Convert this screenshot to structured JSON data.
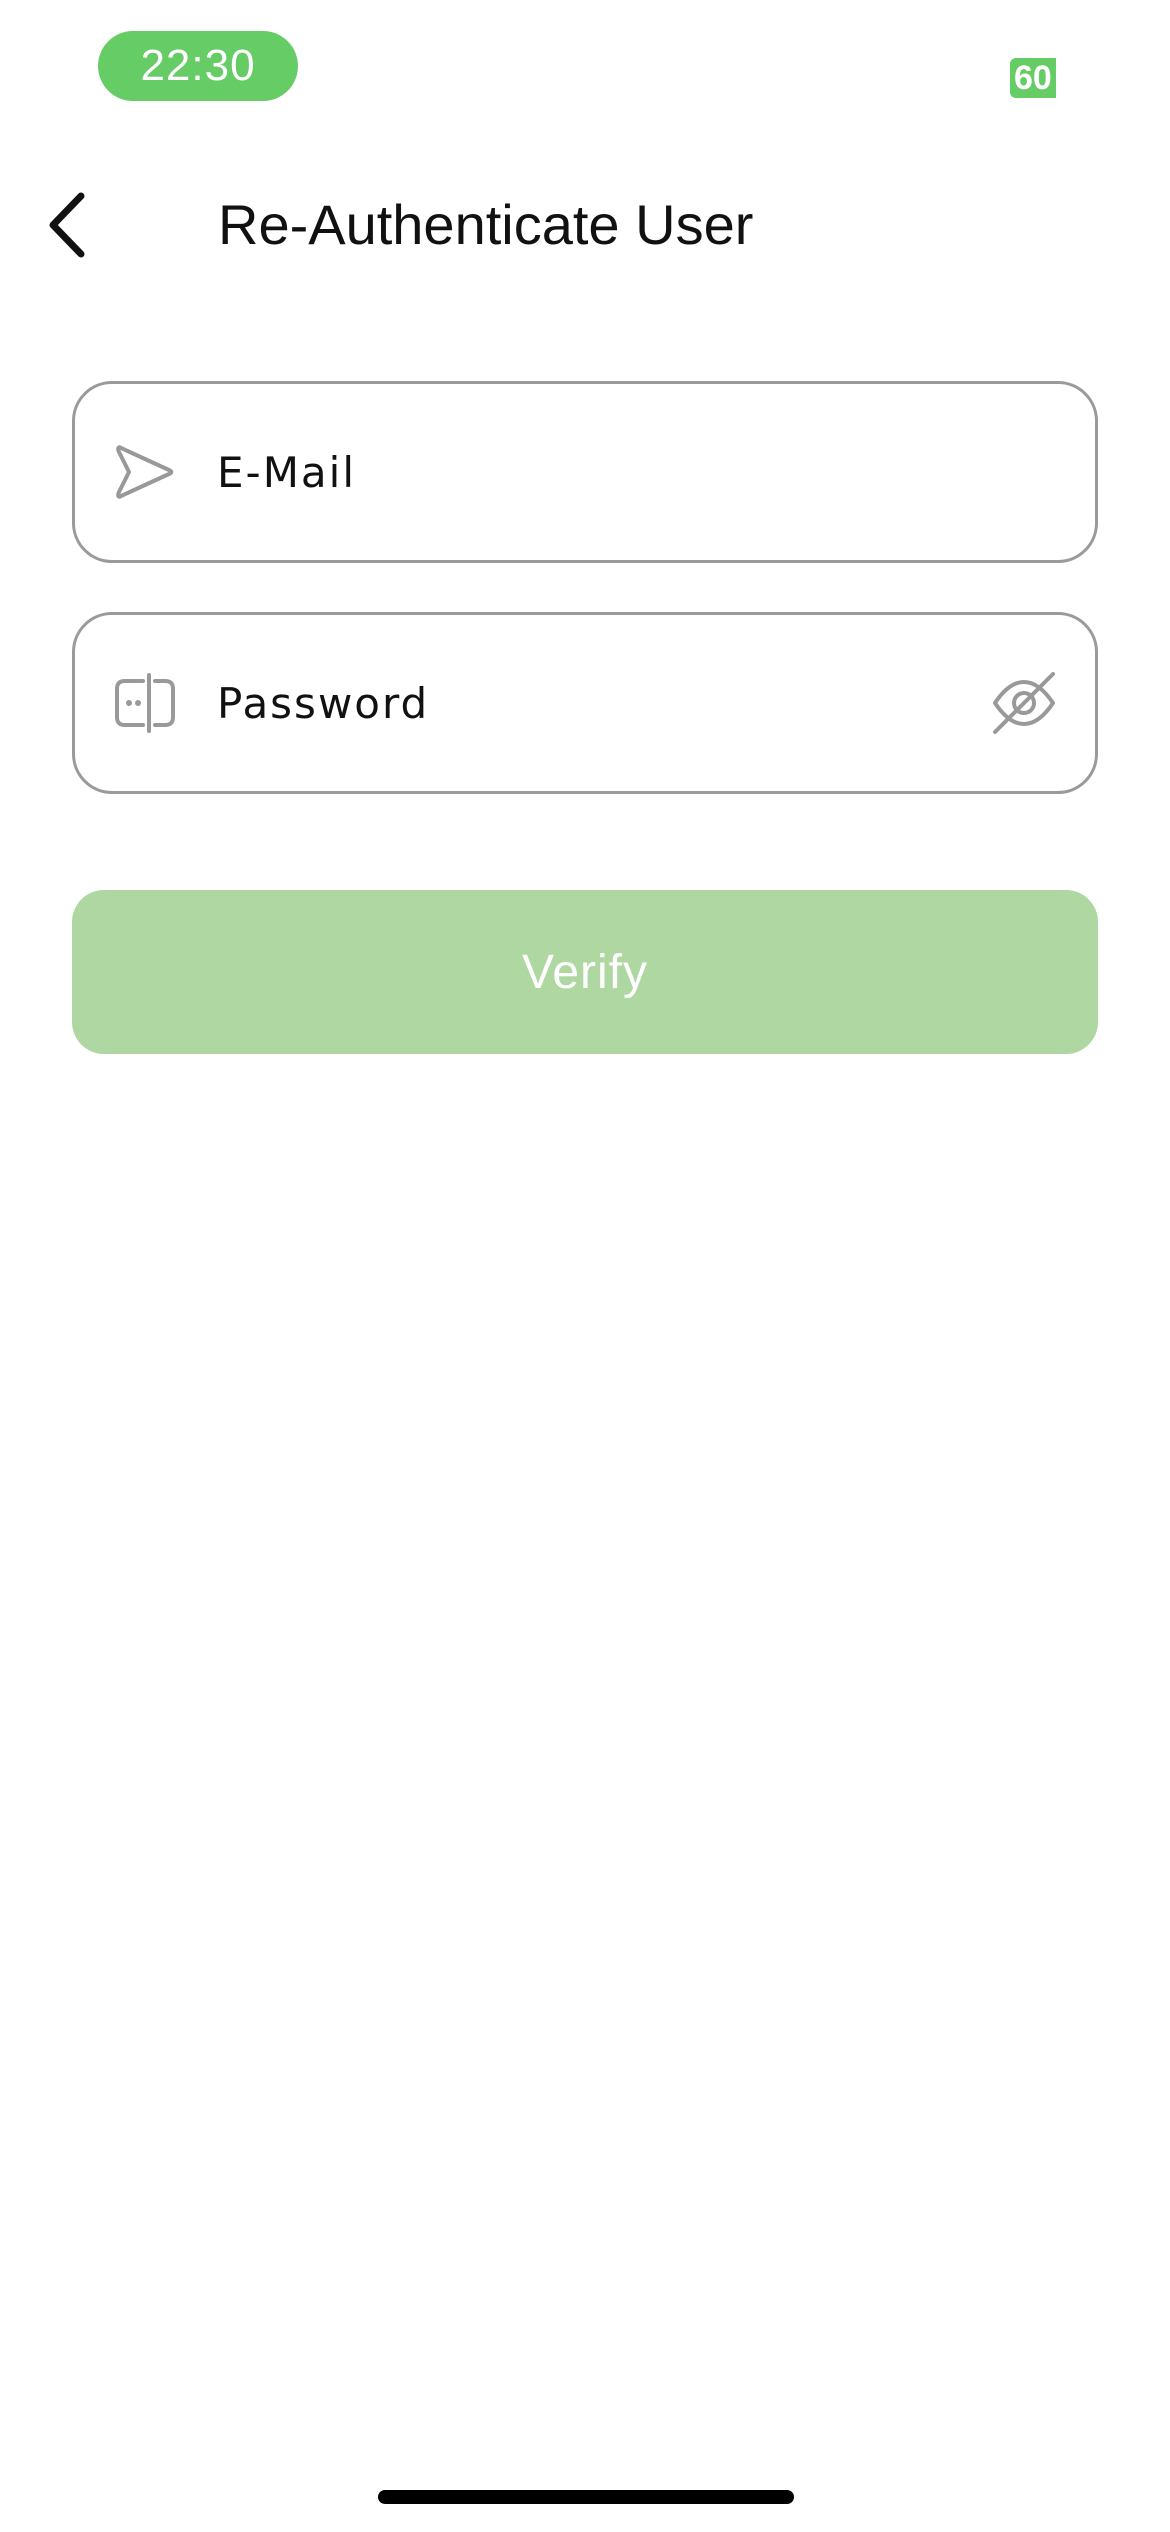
{
  "status_bar": {
    "time": "22:30",
    "battery": "60",
    "accent_color": "#66cc66"
  },
  "header": {
    "back_icon": "chevron-left-icon",
    "title": "Re-Authenticate User"
  },
  "form": {
    "email": {
      "placeholder": "E-Mail",
      "value": "",
      "icon": "send-icon"
    },
    "password": {
      "placeholder": "Password",
      "value": "",
      "icon": "password-icon",
      "toggle_icon": "eye-off-icon"
    },
    "verify_label": "Verify",
    "verify_color": "#afd7a1"
  }
}
